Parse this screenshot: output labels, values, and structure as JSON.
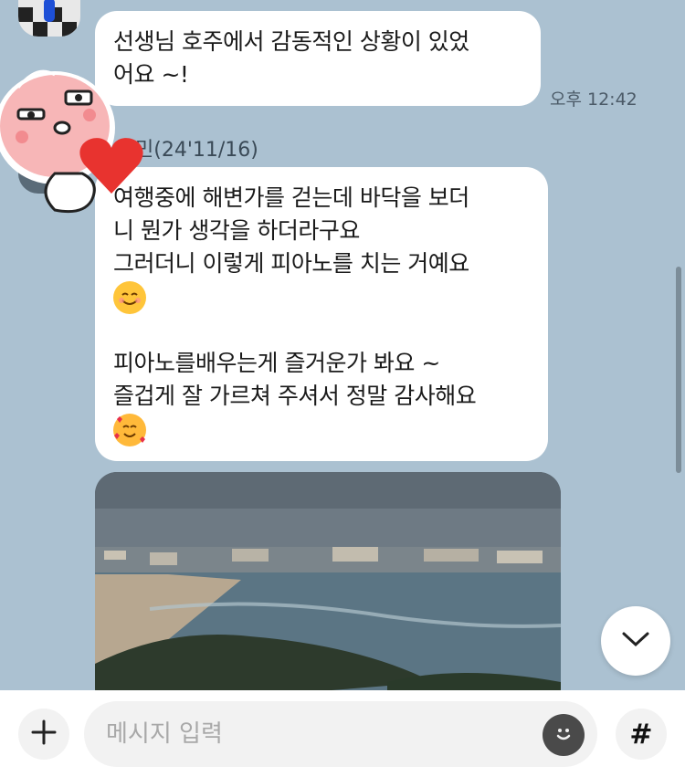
{
  "messages": [
    {
      "lines": [
        "선생님 호주에서 감동적인 상황이 있었",
        "어요 ~!"
      ],
      "time": "오후 12:42"
    },
    {
      "sender": "민(24'11/16)",
      "line1": "여행중에 해변가를 걷는데 바닥을 보더",
      "line2": "니 뭔가 생각을 하더라구요",
      "line3": "그러더니 이렇게 피아노를 치는 거예요",
      "line4": "피아노를배우는게 즐거운가 봐요 ~",
      "line5": "즐겁게 잘 가르쳐 주셔서 정말 감사해요",
      "emoji_1": "smiling-face-icon",
      "emoji_2": "smiling-face-with-hearts-icon"
    }
  ],
  "composer": {
    "placeholder": "메시지 입력",
    "hash_label": "#"
  },
  "colors": {
    "chat_background": "#abc1d1",
    "bubble": "#ffffff",
    "input_bar": "#ffffff"
  }
}
